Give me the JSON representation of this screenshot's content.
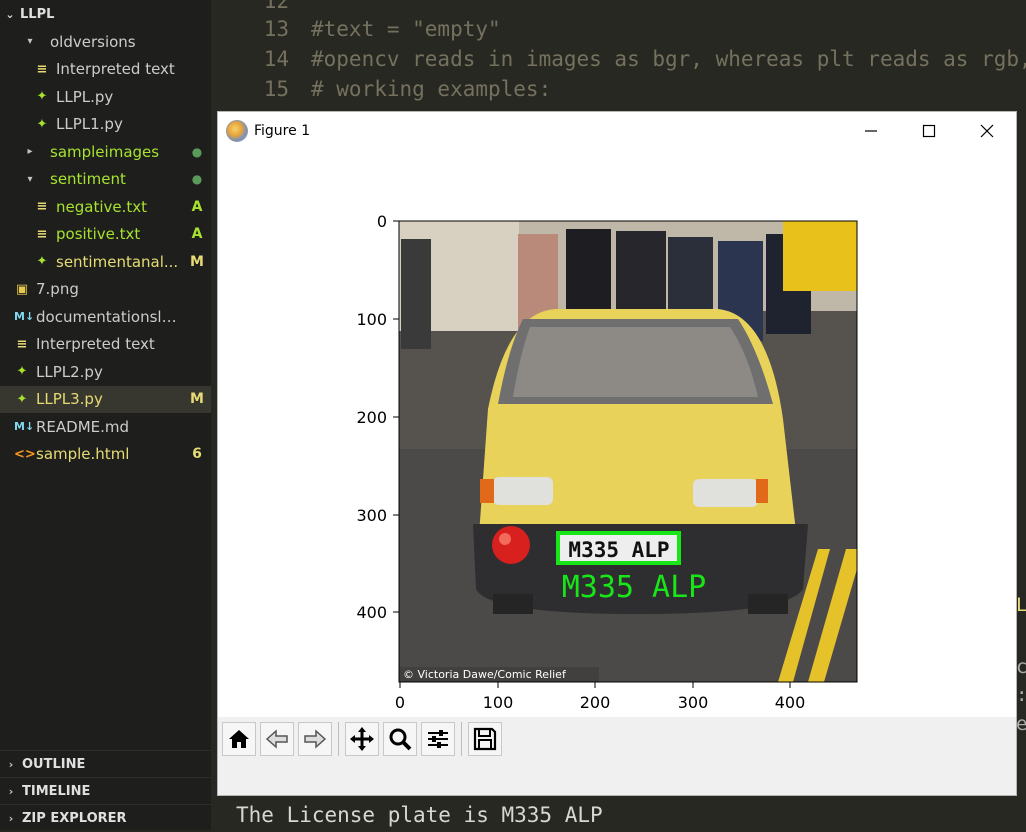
{
  "sidebar": {
    "root_label": "LLPL",
    "items": [
      {
        "label": "oldversions",
        "type": "folder",
        "expanded": true,
        "icon": "folder",
        "color": "#cccccc",
        "badge": ""
      },
      {
        "label": "Interpreted text",
        "type": "file",
        "icon": "text-file-icon",
        "color": "#cccccc",
        "badge": ""
      },
      {
        "label": "LLPL.py",
        "type": "file",
        "icon": "python-icon",
        "color": "#cccccc",
        "badge": ""
      },
      {
        "label": "LLPL1.py",
        "type": "file",
        "icon": "python-icon",
        "color": "#cccccc",
        "badge": ""
      },
      {
        "label": "sampleimages",
        "type": "folder",
        "expanded": false,
        "icon": "folder",
        "color": "#a6e22e",
        "badge": "●"
      },
      {
        "label": "sentiment",
        "type": "folder",
        "expanded": true,
        "icon": "folder",
        "color": "#a6e22e",
        "badge": "●"
      },
      {
        "label": "negative.txt",
        "type": "file",
        "icon": "text-file-icon",
        "color": "#a6e22e",
        "badge": "A"
      },
      {
        "label": "positive.txt",
        "type": "file",
        "icon": "text-file-icon",
        "color": "#a6e22e",
        "badge": "A"
      },
      {
        "label": "sentimentanal...",
        "type": "file",
        "icon": "python-icon",
        "color": "#e6db74",
        "badge": "M"
      },
      {
        "label": "7.png",
        "type": "file",
        "icon": "image-icon",
        "color": "#cccccc",
        "badge": ""
      },
      {
        "label": "documentationslashb...",
        "type": "file",
        "icon": "markdown-icon",
        "color": "#cccccc",
        "badge": ""
      },
      {
        "label": "Interpreted text",
        "type": "file",
        "icon": "text-file-icon",
        "color": "#cccccc",
        "badge": ""
      },
      {
        "label": "LLPL2.py",
        "type": "file",
        "icon": "python-icon",
        "color": "#cccccc",
        "badge": ""
      },
      {
        "label": "LLPL3.py",
        "type": "file",
        "icon": "python-icon",
        "color": "#e6db74",
        "badge": "M",
        "selected": true
      },
      {
        "label": "README.md",
        "type": "file",
        "icon": "markdown-icon",
        "color": "#cccccc",
        "badge": ""
      },
      {
        "label": "sample.html",
        "type": "file",
        "icon": "html-icon",
        "color": "#e6db74",
        "badge": "6"
      }
    ],
    "bottom_sections": [
      "OUTLINE",
      "TIMELINE",
      "ZIP EXPLORER"
    ]
  },
  "editor": {
    "lines": [
      {
        "num": "12",
        "text": ""
      },
      {
        "num": "13",
        "text": "#text = \"empty\""
      },
      {
        "num": "14",
        "text": "#opencv reads in images as bgr, whereas plt reads as rgb,"
      },
      {
        "num": "15",
        "text": "# working examples:"
      }
    ],
    "terminal_output": "The License plate is M335 ALP",
    "edge_chars": [
      "L",
      "c",
      ":",
      "e"
    ]
  },
  "figure": {
    "title": "Figure 1",
    "minimize_glyph": "—",
    "maximize_glyph": "☐",
    "close_glyph": "✕",
    "x_ticks": [
      "0",
      "100",
      "200",
      "300",
      "400"
    ],
    "y_ticks": [
      "0",
      "100",
      "200",
      "300",
      "400"
    ],
    "plate_text": "M335 ALP",
    "detected_text": "M335 ALP",
    "photo_credit": "© Victoria Dawe/Comic Relief",
    "toolbar_buttons": [
      "home-icon",
      "back-icon",
      "forward-icon",
      "pan-icon",
      "zoom-icon",
      "configure-subplots-icon",
      "save-icon"
    ]
  },
  "colors": {
    "sidebar_bg": "#1e1f1c",
    "editor_bg": "#272822",
    "accent_green": "#a6e22e",
    "modified_gold": "#e6db74",
    "detection_green": "#18e618"
  }
}
